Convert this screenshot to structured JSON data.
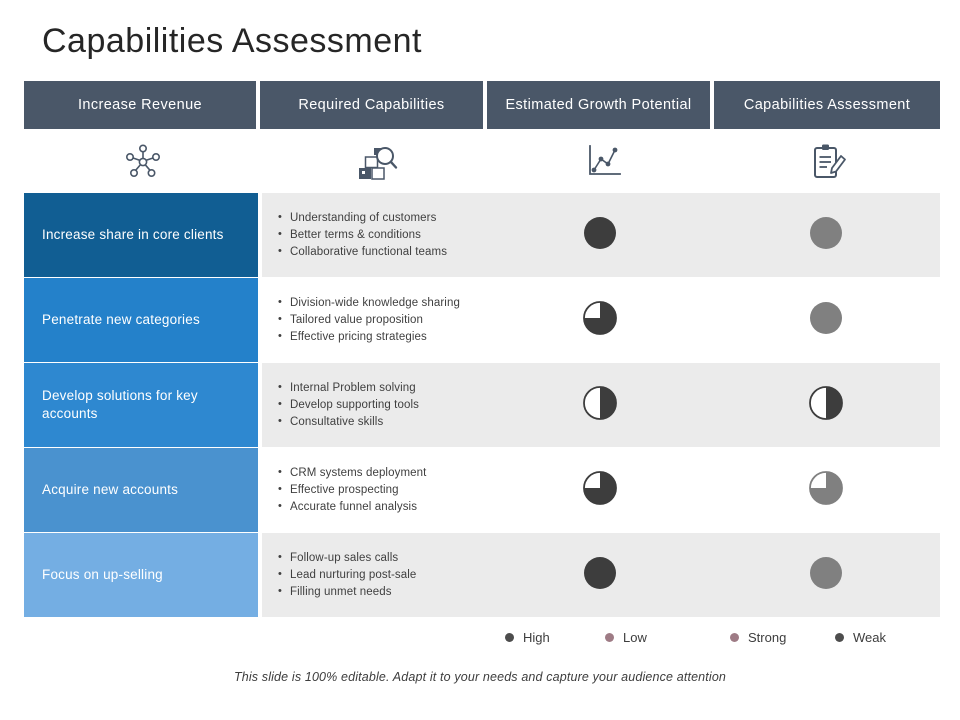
{
  "slide": {
    "title": "Capabilities Assessment",
    "footer_note": "This slide is 100% editable. Adapt it to your needs and capture your audience attention"
  },
  "colors": {
    "header_bar": "#4a5768",
    "row_band_gray": "#ebebeb",
    "row_band_white": "#ffffff",
    "ball_dark": "#3d3d3d",
    "ball_gray": "#808080",
    "legend_mauve": "#9e7b85",
    "legend_dark": "#4d4d4d",
    "objective_blues": [
      "#115e93",
      "#2481ca",
      "#2e88d0",
      "#4a92cf",
      "#74aee3"
    ]
  },
  "table": {
    "headers": [
      {
        "label": "Increase Revenue",
        "icon": "network-nodes-icon"
      },
      {
        "label": "Required Capabilities",
        "icon": "boxes-magnifier-icon"
      },
      {
        "label": "Estimated Growth Potential",
        "icon": "line-chart-icon"
      },
      {
        "label": "Capabilities Assessment",
        "icon": "clipboard-pencil-icon"
      }
    ],
    "rows": [
      {
        "objective": "Increase share in core clients",
        "objective_color": "#115e93",
        "band": "gray",
        "capabilities": [
          "Understanding  of customers",
          "Better terms & conditions",
          "Collaborative  functional teams"
        ],
        "growth_potential": {
          "fill": 1.0,
          "color": "#3d3d3d",
          "label": "High"
        },
        "capabilities_assessment": {
          "fill": 1.0,
          "color": "#808080",
          "label": "Weak"
        }
      },
      {
        "objective": "Penetrate new categories",
        "objective_color": "#2481ca",
        "band": "white",
        "capabilities": [
          "Division-wide  knowledge sharing",
          "Tailored  value  proposition",
          "Effective  pricing  strategies"
        ],
        "growth_potential": {
          "fill": 0.75,
          "color": "#3d3d3d",
          "label": "High"
        },
        "capabilities_assessment": {
          "fill": 1.0,
          "color": "#808080",
          "label": "Weak"
        }
      },
      {
        "objective": "Develop solutions for key accounts",
        "objective_color": "#2e88d0",
        "band": "gray",
        "capabilities": [
          "Internal  Problem solving",
          "Develop  supporting tools",
          "Consultative  skills"
        ],
        "growth_potential": {
          "fill": 0.5,
          "color": "#3d3d3d",
          "label": "High"
        },
        "capabilities_assessment": {
          "fill": 0.5,
          "color": "#3d3d3d",
          "label": "Weak"
        }
      },
      {
        "objective": "Acquire new accounts",
        "objective_color": "#4a92cf",
        "band": "white",
        "capabilities": [
          "CRM  systems deployment",
          "Effective  prospecting",
          "Accurate funnel  analysis"
        ],
        "growth_potential": {
          "fill": 0.75,
          "color": "#3d3d3d",
          "label": "High"
        },
        "capabilities_assessment": {
          "fill": 0.75,
          "color": "#808080",
          "label": "Weak"
        }
      },
      {
        "objective": "Focus on up-selling",
        "objective_color": "#74aee3",
        "band": "gray",
        "capabilities": [
          "Follow-up  sales calls",
          "Lead  nurturing  post-sale",
          "Filling unmet  needs"
        ],
        "growth_potential": {
          "fill": 1.0,
          "color": "#3d3d3d",
          "label": "High"
        },
        "capabilities_assessment": {
          "fill": 1.0,
          "color": "#808080",
          "label": "Weak"
        }
      }
    ]
  },
  "legend": [
    {
      "label": "High",
      "color": "#4d4d4d"
    },
    {
      "label": "Low",
      "color": "#9e7b85"
    },
    {
      "label": "Strong",
      "color": "#9e7b85"
    },
    {
      "label": "Weak",
      "color": "#4d4d4d"
    }
  ]
}
